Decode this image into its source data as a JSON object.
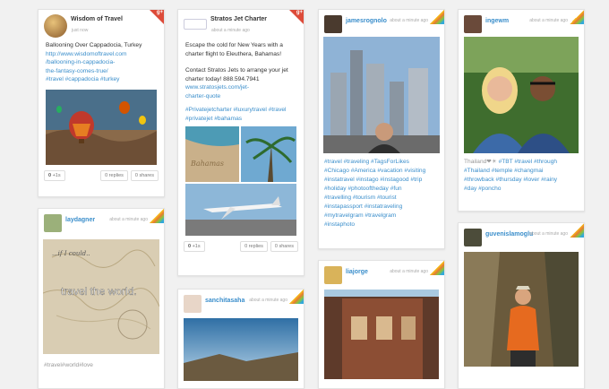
{
  "cards": {
    "c1": {
      "user": "Wisdom of Travel",
      "time": "just now",
      "text": "Ballooning Over Cappadocia, Turkey",
      "link": "http://www.wisdomoftravel.com/ballooning-in-cappadocia-the-fantasy-comes-true/",
      "link_lines": [
        "http://www.wisdomoftravel.com",
        "/ballooning-in-cappadocia-",
        "the-fantasy-comes-true/"
      ],
      "tags": "#travel  #cappadocia  #turkey",
      "stats": {
        "plus": "+1s",
        "replies": "0 replies",
        "shares": "0 shares"
      }
    },
    "c2": {
      "user": "laydagner",
      "time": "about a minute ago",
      "caption": "travel the world.",
      "tags": "#travel#world#love"
    },
    "c3": {
      "user": "Stratos Jet Charter",
      "time": "about a minute ago",
      "text1": "Escape the cold for New Years with a charter flight to Eleuthera, Bahamas!",
      "text2": "Contact Stratos Jets to arrange your jet charter today!  888.594.7941",
      "link_lines": [
        "www.stratosjets.com/jet-",
        "charter-quote"
      ],
      "tags": "#Privatejetcharter   #luxurytravel  #travel   #privatejet   #bahamas",
      "sand_text": "Bahamas",
      "stats": {
        "plus": "+1s",
        "replies": "0 replies",
        "shares": "0 shares"
      }
    },
    "c4": {
      "user": "sanchitasaha",
      "time": "about a minute ago"
    },
    "c5": {
      "user": "jamesrognolo",
      "time": "about a minute ago",
      "tags": [
        "#travel #traveling #TagsForLikes",
        "#Chicago #America #vacation #visiting",
        "#instatravel #instago #instagood #trip",
        "#holiday #photooftheday #fun",
        "#travelling #tourism #tourist",
        "#instapassport #instatraveling",
        "#mytravelgram #travelgram",
        "#instaphoto"
      ]
    },
    "c6": {
      "user": "liajorge",
      "time": "about a minute ago"
    },
    "c7": {
      "user": "ingewm",
      "time": "about a minute ago",
      "tags_prefix": "Thailand❤☀ ",
      "tags": [
        "#TBT #travel #through",
        "#Thailand #temple #changmai",
        "#throwback #thursday #lover #rainy",
        "#day #poncho"
      ]
    },
    "c8": {
      "user": "guvenislamoglu",
      "time": "about a minute ago"
    }
  },
  "colors": {
    "link": "#3a8ecb",
    "gplus": "#dd4b39"
  }
}
